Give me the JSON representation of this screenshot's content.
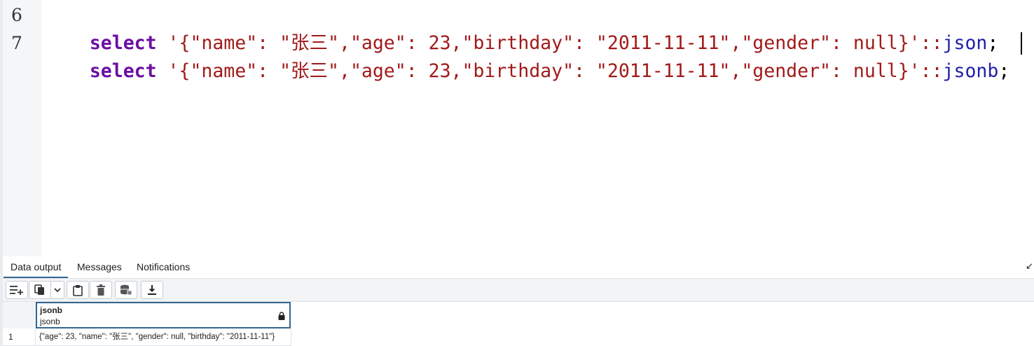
{
  "editor": {
    "colors": {
      "keyword": "#6b0fa3",
      "string": "#a11a1a",
      "type": "#1f1fa8",
      "plain": "#000000"
    },
    "lines": [
      {
        "number": "6",
        "keyword": "select",
        "literal": "'{\"name\": \"张三\",\"age\": 23,\"birthday\": \"2011-11-11\",\"gender\": null}'",
        "cast": "::",
        "type": "json",
        "end": ";"
      },
      {
        "number": "7",
        "keyword": "select",
        "literal": "'{\"name\": \"张三\",\"age\": 23,\"birthday\": \"2011-11-11\",\"gender\": null}'",
        "cast": "::",
        "type": "jsonb",
        "end": ";"
      }
    ]
  },
  "panel": {
    "tabs": [
      {
        "label": "Data output",
        "active": true
      },
      {
        "label": "Messages",
        "active": false
      },
      {
        "label": "Notifications",
        "active": false
      }
    ],
    "collapse_icon": "collapse-arrow-icon",
    "toolbar": [
      {
        "name": "add-row-button",
        "icon": "add-row-icon"
      },
      {
        "name": "copy-button",
        "icon": "copy-icon"
      },
      {
        "name": "copy-options-button",
        "icon": "chevron-down-icon"
      },
      {
        "name": "paste-button",
        "icon": "paste-icon"
      },
      {
        "name": "delete-button",
        "icon": "trash-icon"
      },
      {
        "name": "save-data-button",
        "icon": "database-save-icon"
      },
      {
        "name": "download-button",
        "icon": "download-icon"
      }
    ],
    "grid": {
      "column": {
        "name": "jsonb",
        "type": "jsonb",
        "icon": "lock-icon"
      },
      "rows": [
        {
          "num": "1",
          "value": "{\"age\": 23, \"name\": \"张三\", \"gender\": null, \"birthday\": \"2011-11-11\"}"
        }
      ]
    }
  }
}
